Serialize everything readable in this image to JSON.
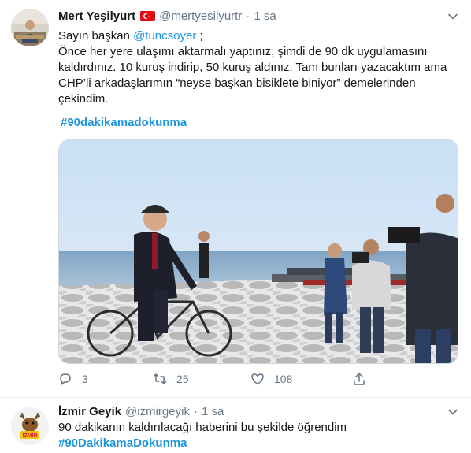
{
  "tweet1": {
    "author_name": "Mert Yeşilyurt",
    "author_handle": "@mertyesilyurtr",
    "separator": "·",
    "time": "1 sa",
    "line_greeting": "Sayın başkan ",
    "mention": "@tuncsoyer",
    "mention_suffix": " ;",
    "body": "Önce her yere ulaşımı aktarmalı yaptınız, şimdi de 90 dk uygulamasını kaldırdınız. 10 kuruş indirip, 50 kuruş aldınız. Tam bunları yazacaktım ama CHP’li arkadaşlarımın “neyse başkan bisiklete biniyor” demelerinden çekindim.",
    "hashtag": "#90dakikamadokunma",
    "replies": "3",
    "retweets": "25",
    "likes": "108"
  },
  "tweet2": {
    "author_name": "İzmir Geyik",
    "author_handle": "@izmirgeyik",
    "separator": "·",
    "time": "1 sa",
    "body": "90 dakikanın kaldırılacağı haberini bu şekilde öğrendim",
    "hashtag": "#90DakikamaDokunma",
    "avatar_text": "İZMİR"
  },
  "colors": {
    "link": "#1b95e0",
    "muted": "#657786",
    "text": "#14171a",
    "border": "#e6ecf0"
  },
  "icons": [
    "caret-down-icon",
    "reply-icon",
    "retweet-icon",
    "like-icon",
    "share-icon",
    "turkey-flag-icon"
  ]
}
